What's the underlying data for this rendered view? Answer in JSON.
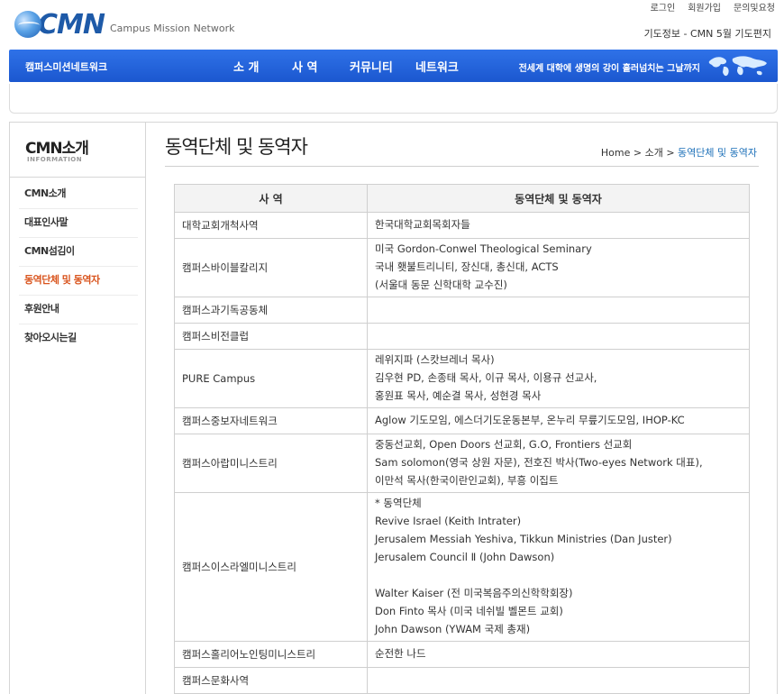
{
  "header": {
    "logo_text": "CMN",
    "logo_sub": "Campus Mission Network",
    "util_links": [
      "로그인",
      "회원가입",
      "문의및요청"
    ],
    "ticker": "기도정보 - CMN 5월 기도편지"
  },
  "gnb": {
    "brand": "캠퍼스미션네트워크",
    "menu": [
      "소 개",
      "사 역",
      "커뮤니티",
      "네트워크"
    ],
    "slogan": "전세계 대학에 생명의 강이 흘러넘치는 그날까지"
  },
  "lnb": {
    "title": "CMN소개",
    "title_en": "INFORMATION",
    "items": [
      "CMN소개",
      "대표인사말",
      "CMN섬김이",
      "동역단체 및 동역자",
      "후원안내",
      "찾아오시는길"
    ],
    "active_index": 3
  },
  "page": {
    "title": "동역단체 및 동역자",
    "breadcrumb": {
      "home": "Home",
      "sep": ">",
      "level1": "소개",
      "current": "동역단체 및 동역자"
    }
  },
  "table": {
    "headers": [
      "사 역",
      "동역단체 및 동역자"
    ],
    "rows": [
      {
        "ministry": "대학교회개척사역",
        "partners": [
          "한국대학교회목회자들"
        ]
      },
      {
        "ministry": "캠퍼스바이블칼리지",
        "partners": [
          "미국 Gordon-Conwel Theological Seminary",
          "국내 횃불트리니티, 장신대, 총신대, ACTS",
          "(서울대 동문 신학대학 교수진)"
        ]
      },
      {
        "ministry": "캠퍼스과기독공동체",
        "partners": [
          ""
        ]
      },
      {
        "ministry": "캠퍼스비전클럽",
        "partners": [
          ""
        ]
      },
      {
        "ministry": "PURE Campus",
        "partners": [
          "레위지파 (스캇브레너 목사)",
          "김우현 PD, 손종태 목사, 이규 목사, 이용규 선교사,",
          "홍원표 목사, 예순결 목사, 성현경 목사"
        ]
      },
      {
        "ministry": "캠퍼스중보자네트워크",
        "partners": [
          "Aglow 기도모임, 에스더기도운동본부, 온누리 무릎기도모임, IHOP-KC"
        ]
      },
      {
        "ministry": "캠퍼스아랍미니스트리",
        "partners": [
          "중동선교회, Open Doors 선교회, G.O, Frontiers 선교회",
          "Sam solomon(영국 상원 자문), 전호진 박사(Two-eyes Network 대표),",
          "이만석 목사(한국이란인교회), 부흥 이집트"
        ]
      },
      {
        "ministry": "캠퍼스이스라엘미니스트리",
        "partners": [
          "* 동역단체",
          "Revive Israel (Keith Intrater)",
          "Jerusalem Messiah Yeshiva, Tikkun Ministries (Dan Juster)",
          "Jerusalem Council Ⅱ (John Dawson)",
          "",
          "Walter Kaiser (전 미국복음주의신학학회장)",
          "Don Finto 목사 (미국 네쉬빌 벨몬트 교회)",
          "John Dawson (YWAM 국제 총재)"
        ]
      },
      {
        "ministry": "캠퍼스홀리어노인팅미니스트리",
        "partners": [
          "순전한 나드"
        ]
      },
      {
        "ministry": "캠퍼스문화사역",
        "partners": [
          ""
        ]
      }
    ]
  },
  "colors": {
    "gnb_blue": "#2563dc",
    "active_orange": "#d9541d",
    "crumb_blue": "#1b6fb8"
  }
}
